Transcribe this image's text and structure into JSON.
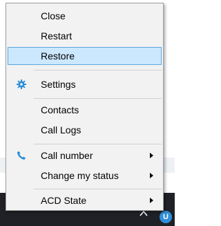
{
  "menu": {
    "items": [
      {
        "label": "Close"
      },
      {
        "label": "Restart"
      },
      {
        "label": "Restore"
      },
      {
        "label": "Settings",
        "icon": "gear-icon"
      },
      {
        "label": "Contacts"
      },
      {
        "label": "Call Logs"
      },
      {
        "label": "Call number",
        "icon": "phone-icon"
      },
      {
        "label": "Change my status"
      },
      {
        "label": "ACD State"
      }
    ]
  },
  "tray": {
    "badge_text": "U",
    "badge_color": "#2f8fd8"
  },
  "colors": {
    "highlight": "#cce8ff",
    "highlight_border": "#5ca6dd",
    "accent_icon": "#2f8fd8",
    "taskbar": "#1f2126"
  }
}
